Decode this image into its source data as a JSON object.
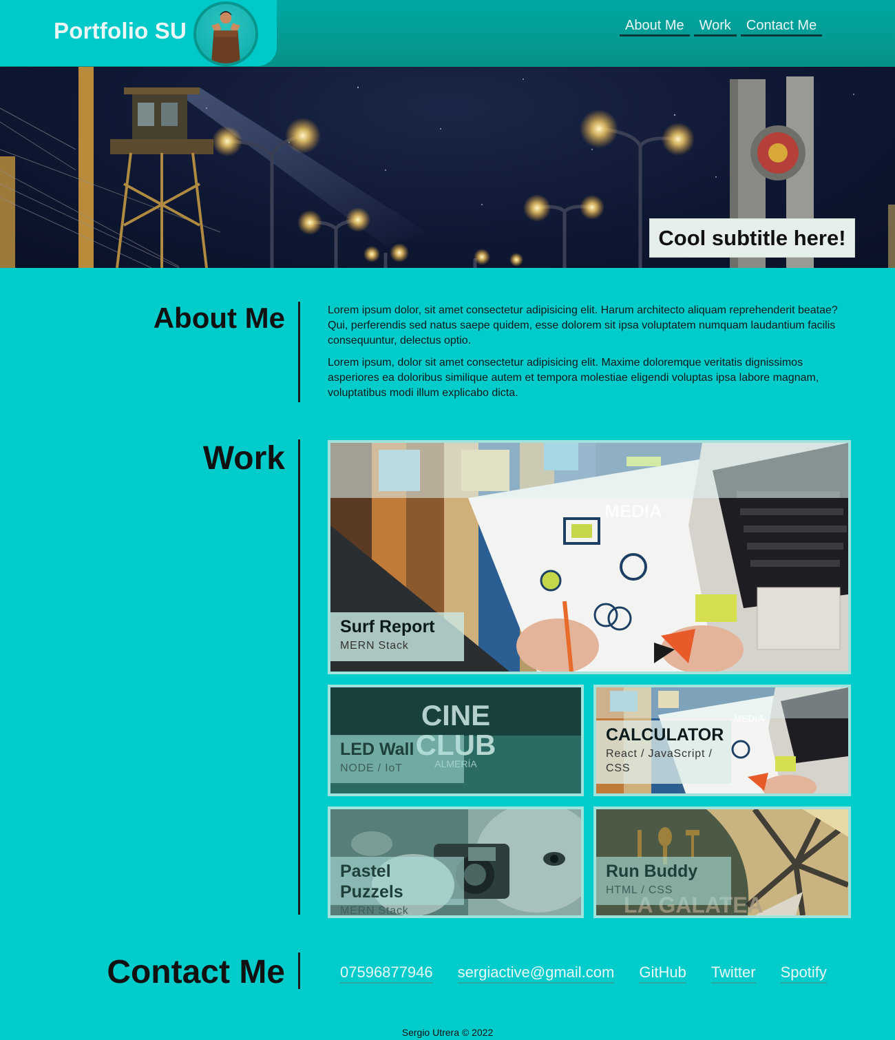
{
  "header": {
    "brand": "Portfolio SU",
    "nav": [
      "About Me",
      "Work",
      "Contact Me"
    ]
  },
  "hero": {
    "subtitle": "Cool subtitle here!"
  },
  "about": {
    "heading": "About Me",
    "paragraphs": [
      "Lorem ipsum dolor, sit amet consectetur adipisicing elit. Harum architecto aliquam reprehenderit beatae? Qui, perferendis sed natus saepe quidem, esse dolorem sit ipsa voluptatem numquam laudantium facilis consequuntur, delectus optio.",
      "Lorem ipsum, dolor sit amet consectetur adipisicing elit. Maxime doloremque veritatis dignissimos asperiores ea doloribus similique autem et tempora molestiae eligendi voluptas ipsa labore magnam, voluptatibus modi illum explicabo dicta."
    ]
  },
  "work": {
    "heading": "Work",
    "projects": [
      {
        "title": "Surf Report",
        "stack": "MERN Stack",
        "image_text": "MEDIA"
      },
      {
        "title": "LED Wall",
        "stack": "NODE / IoT",
        "image_text": [
          "CINE",
          "CLUB",
          "ALMERÍA"
        ]
      },
      {
        "title": "CALCULATOR",
        "stack": "React / JavaScript / CSS",
        "image_text": "MEDIA"
      },
      {
        "title": "Pastel Puzzels",
        "stack": "MERN Stack"
      },
      {
        "title": "Run Buddy",
        "stack": "HTML / CSS",
        "image_text": "LA GALATEA"
      }
    ]
  },
  "contact": {
    "heading": "Contact Me",
    "links": [
      "07596877946",
      "sergiactive@gmail.com",
      "GitHub",
      "Twitter",
      "Spotify"
    ]
  },
  "footer": {
    "text": "Sergio Utrera © 2022"
  },
  "colors": {
    "page_bg": "#00cccc",
    "header_bg": "#069188",
    "brand_pill": "#00c9c9",
    "card_border": "#9ee3dc"
  }
}
